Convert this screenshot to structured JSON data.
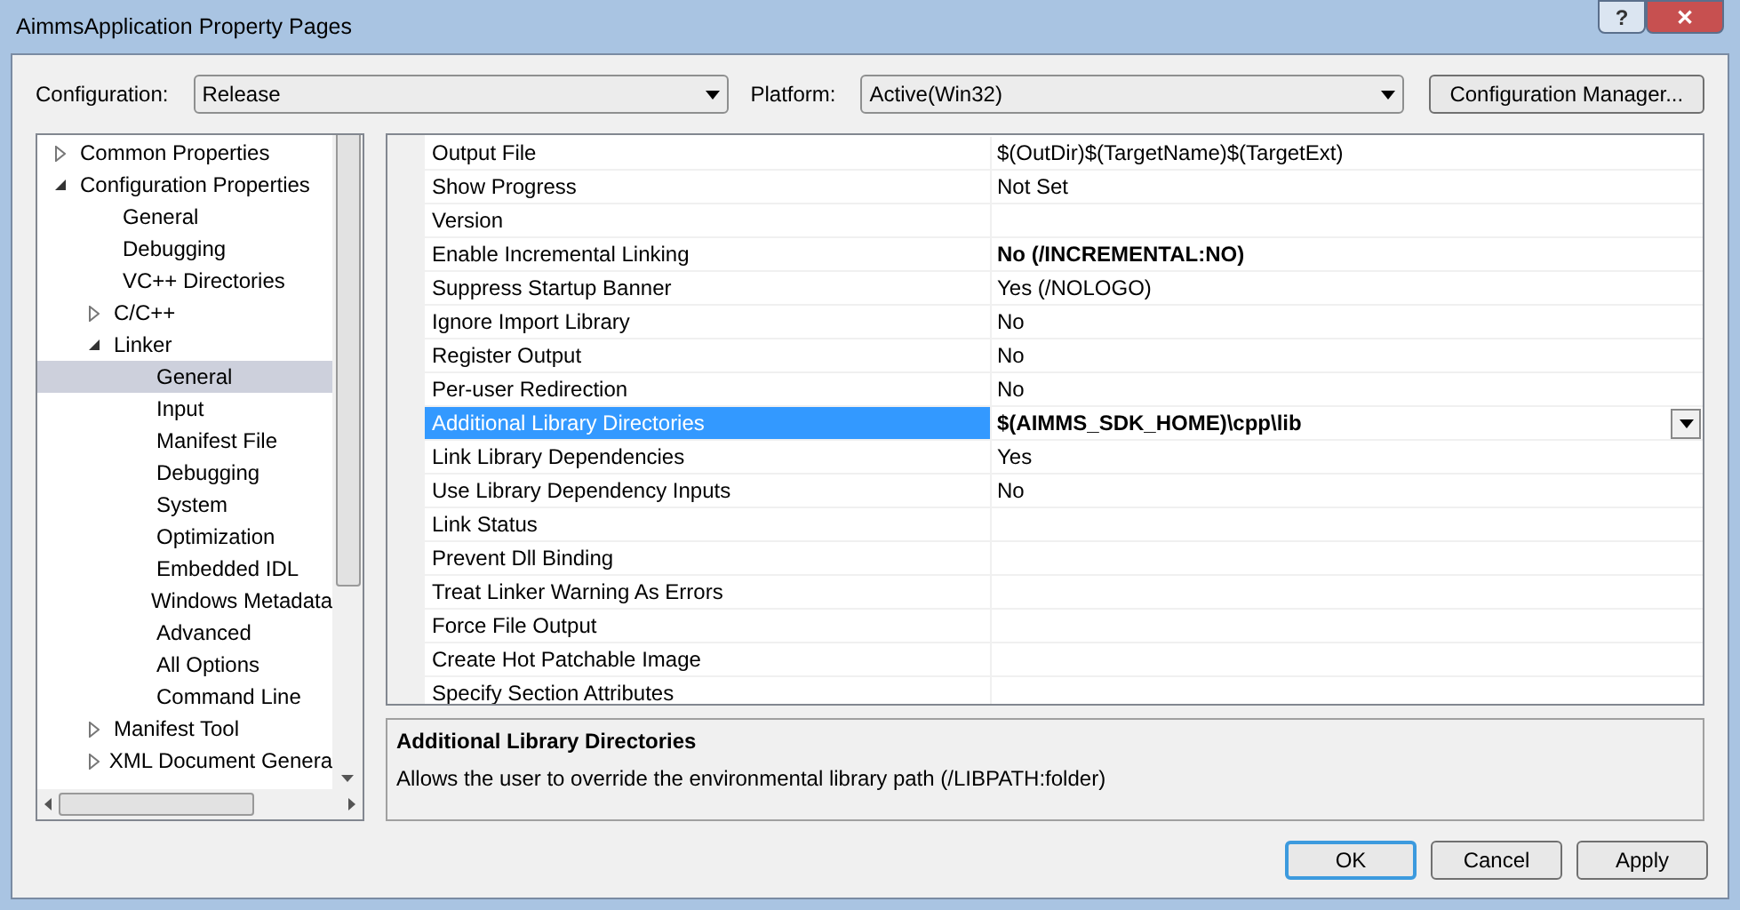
{
  "window": {
    "title": "AimmsApplication Property Pages"
  },
  "title_buttons": [
    {
      "kind": "help",
      "label": "?"
    },
    {
      "kind": "close",
      "label": "✕"
    }
  ],
  "configuration": {
    "label": "Configuration:",
    "value": "Release"
  },
  "platform": {
    "label": "Platform:",
    "value": "Active(Win32)"
  },
  "configuration_manager_button": "Configuration Manager...",
  "tree": [
    {
      "label": "Common Properties",
      "expanded": false,
      "selected": false
    },
    {
      "label": "Configuration Properties",
      "expanded": true,
      "selected": false,
      "children": [
        {
          "label": "General",
          "selected": false
        },
        {
          "label": "Debugging",
          "selected": false
        },
        {
          "label": "VC++ Directories",
          "selected": false
        },
        {
          "label": "C/C++",
          "expanded": false,
          "selected": false
        },
        {
          "label": "Linker",
          "expanded": true,
          "selected": false,
          "children": [
            {
              "label": "General",
              "selected": true
            },
            {
              "label": "Input",
              "selected": false
            },
            {
              "label": "Manifest File",
              "selected": false
            },
            {
              "label": "Debugging",
              "selected": false
            },
            {
              "label": "System",
              "selected": false
            },
            {
              "label": "Optimization",
              "selected": false
            },
            {
              "label": "Embedded IDL",
              "selected": false
            },
            {
              "label": "Windows Metadata",
              "selected": false
            },
            {
              "label": "Advanced",
              "selected": false
            },
            {
              "label": "All Options",
              "selected": false
            },
            {
              "label": "Command Line",
              "selected": false
            }
          ]
        },
        {
          "label": "Manifest Tool",
          "expanded": false,
          "selected": false
        },
        {
          "label": "XML Document Genera",
          "expanded": false,
          "selected": false
        }
      ]
    }
  ],
  "properties": [
    {
      "name": "Output File",
      "value": "$(OutDir)$(TargetName)$(TargetExt)",
      "bold": false,
      "selected": false
    },
    {
      "name": "Show Progress",
      "value": "Not Set",
      "bold": false,
      "selected": false
    },
    {
      "name": "Version",
      "selected": false
    },
    {
      "name": "Enable Incremental Linking",
      "value": "No (/INCREMENTAL:NO)",
      "bold": true,
      "selected": false
    },
    {
      "name": "Suppress Startup Banner",
      "value": "Yes (/NOLOGO)",
      "bold": false,
      "selected": false
    },
    {
      "name": "Ignore Import Library",
      "value": "No",
      "bold": false,
      "selected": false
    },
    {
      "name": "Register Output",
      "value": "No",
      "bold": false,
      "selected": false
    },
    {
      "name": "Per-user Redirection",
      "value": "No",
      "bold": false,
      "selected": false
    },
    {
      "name": "Additional Library Directories",
      "value": "$(AIMMS_SDK_HOME)\\cpp\\lib",
      "bold": true,
      "selected": true
    },
    {
      "name": "Link Library Dependencies",
      "value": "Yes",
      "bold": false,
      "selected": false
    },
    {
      "name": "Use Library Dependency Inputs",
      "value": "No",
      "bold": false,
      "selected": false
    },
    {
      "name": "Link Status",
      "selected": false
    },
    {
      "name": "Prevent Dll Binding",
      "selected": false
    },
    {
      "name": "Treat Linker Warning As Errors",
      "selected": false
    },
    {
      "name": "Force File Output",
      "selected": false
    },
    {
      "name": "Create Hot Patchable Image",
      "selected": false
    },
    {
      "name": "Specify Section Attributes",
      "selected": false
    }
  ],
  "description": {
    "title": "Additional Library Directories",
    "text": "Allows the user to override the environmental library path (/LIBPATH:folder)"
  },
  "buttons": [
    {
      "label": "OK",
      "default": true
    },
    {
      "label": "Cancel",
      "default": false
    },
    {
      "label": "Apply",
      "default": false
    }
  ]
}
